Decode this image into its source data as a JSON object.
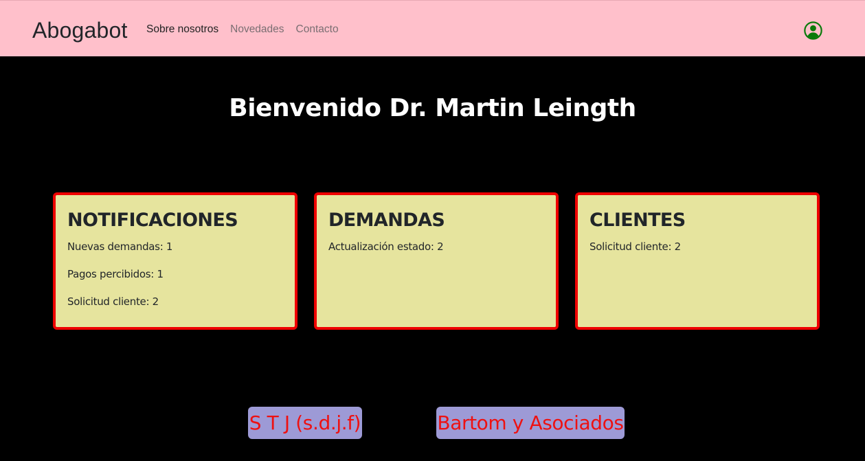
{
  "navbar": {
    "brand": "Abogabot",
    "links": [
      {
        "label": "Sobre nosotros"
      },
      {
        "label": "Novedades"
      },
      {
        "label": "Contacto"
      }
    ],
    "user_icon": "user-circle-icon",
    "background": "#ffc0cb",
    "user_icon_color": "#0a7a0a"
  },
  "main": {
    "welcome": "Bienvenido Dr. Martin Leingth",
    "cards": [
      {
        "title": "NOTIFICACIONES",
        "items": [
          "Nuevas demandas: 1",
          "Pagos percibidos: 1",
          "Solicitud cliente: 2"
        ]
      },
      {
        "title": "DEMANDAS",
        "items": [
          "Actualización estado: 2"
        ]
      },
      {
        "title": "CLIENTES",
        "items": [
          "Solicitud cliente: 2"
        ]
      }
    ],
    "card_background": "#e6e49e",
    "card_border": "#ee0000"
  },
  "footer": {
    "buttons": [
      {
        "label": "S T J (s.d.j.f)"
      },
      {
        "label": "Bartom y Asociados"
      }
    ],
    "button_background": "#9d9ad6",
    "button_text_color": "#ee1111"
  }
}
